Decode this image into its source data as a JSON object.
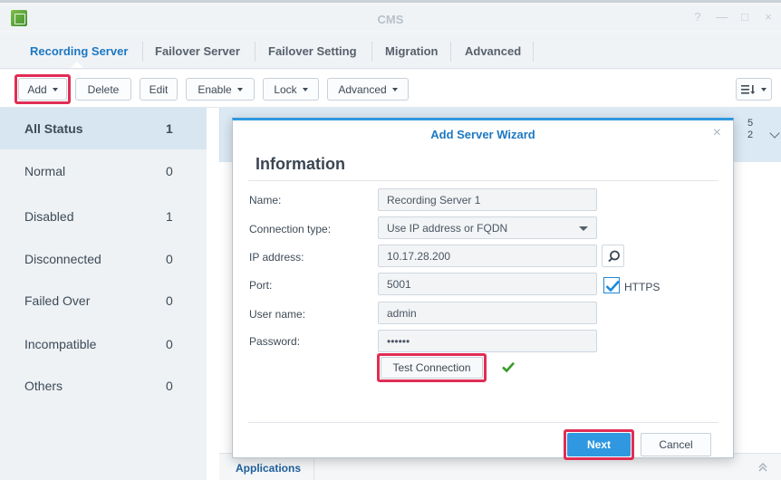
{
  "window": {
    "title": "CMS",
    "controls": [
      "?",
      "—",
      "□",
      "×"
    ]
  },
  "tabs": [
    {
      "label": "Recording Server",
      "active": true
    },
    {
      "label": "Failover Server"
    },
    {
      "label": "Failover Setting"
    },
    {
      "label": "Migration"
    },
    {
      "label": "Advanced"
    }
  ],
  "toolbar": {
    "add": "Add",
    "delete": "Delete",
    "edit": "Edit",
    "enable": "Enable",
    "lock": "Lock",
    "advanced": "Advanced",
    "view_icon": "list-sort-icon"
  },
  "sidebar": {
    "items": [
      {
        "label": "All Status",
        "count": "1",
        "active": true
      },
      {
        "label": "Normal",
        "count": "0"
      },
      {
        "label": "Disabled",
        "count": "1"
      },
      {
        "label": "Disconnected",
        "count": "0"
      },
      {
        "label": "Failed Over",
        "count": "0"
      },
      {
        "label": "Incompatible",
        "count": "0"
      },
      {
        "label": "Others",
        "count": "0"
      }
    ]
  },
  "content": {
    "card_numbers": [
      "5",
      "2"
    ],
    "bottom_tab": "Applications"
  },
  "dialog": {
    "title": "Add Server Wizard",
    "heading": "Information",
    "fields": {
      "name_label": "Name:",
      "name_value": "Recording Server 1",
      "conn_label": "Connection type:",
      "conn_value": "Use IP address or FQDN",
      "ip_label": "IP address:",
      "ip_value": "10.17.28.200",
      "port_label": "Port:",
      "port_value": "5001",
      "https_label": "HTTPS",
      "https_checked": true,
      "user_label": "User name:",
      "user_value": "admin",
      "password_label": "Password:",
      "password_value": "••••••"
    },
    "test_connection": "Test Connection",
    "next": "Next",
    "cancel": "Cancel"
  },
  "colors": {
    "accent": "#2f98e0",
    "highlight": "#e12d55",
    "success": "#3a9a2a"
  }
}
